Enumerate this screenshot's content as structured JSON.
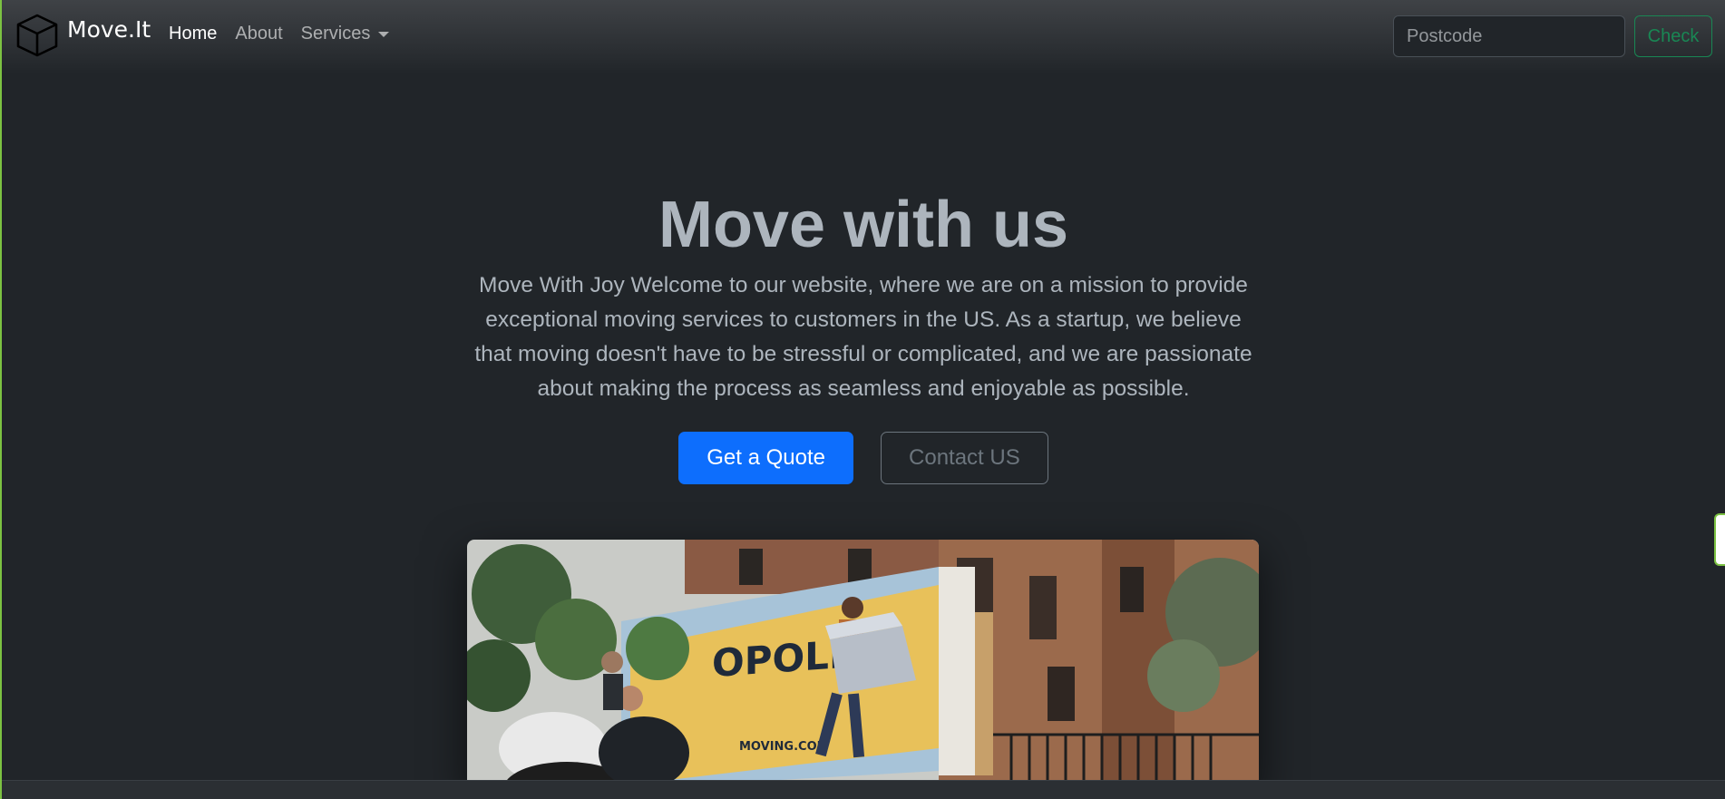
{
  "navbar": {
    "brand": "Move.It",
    "links": [
      {
        "label": "Home",
        "active": true
      },
      {
        "label": "About",
        "active": false
      },
      {
        "label": "Services",
        "active": false,
        "dropdown": true
      }
    ],
    "search": {
      "placeholder": "Postcode",
      "value": "",
      "button_label": "Check"
    }
  },
  "hero": {
    "title": "Move with us",
    "lead": "Move With Joy Welcome to our website, where we are on a mission to provide exceptional moving services to customers in the US. As a startup, we believe that moving doesn't have to be stressful or complicated, and we are passionate about making the process as seamless and enjoyable as possible.",
    "primary_button": "Get a Quote",
    "secondary_button": "Contact US"
  },
  "hero_image": {
    "truck_text": "OPOLIS",
    "truck_subtext": "MOVING.COM"
  },
  "colors": {
    "background": "#212529",
    "primary": "#0d6efd",
    "success": "#198754",
    "muted": "#adb5bd"
  }
}
